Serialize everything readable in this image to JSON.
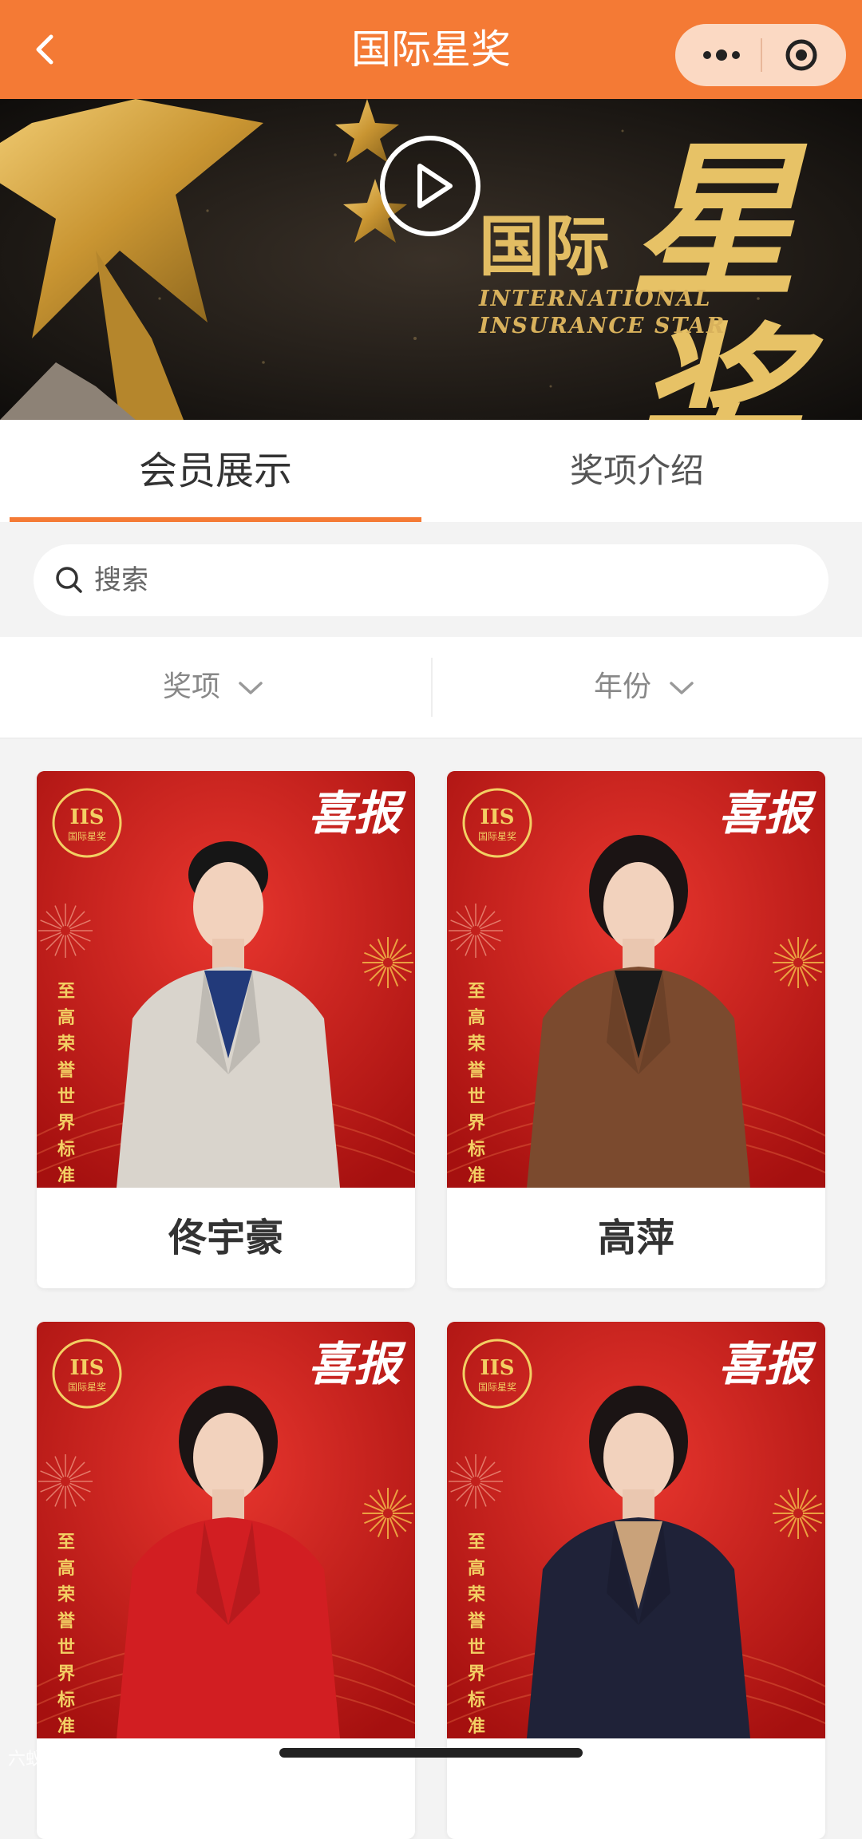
{
  "navbar": {
    "title": "国际星奖"
  },
  "banner": {
    "title_zh_small": "国际",
    "title_zh_big": "星奖",
    "title_en_line1": "INTERNATIONAL",
    "title_en_line2": "INSURANCE STAR"
  },
  "tabs": [
    {
      "label": "会员展示",
      "active": true
    },
    {
      "label": "奖项介绍",
      "active": false
    }
  ],
  "search": {
    "placeholder": "搜索"
  },
  "filters": [
    {
      "label": "奖项"
    },
    {
      "label": "年份"
    }
  ],
  "card_poster": {
    "logo_text": "IIS",
    "logo_sub": "国际星奖",
    "headline": "喜报",
    "vertical_text": "至高荣誉 世界标准"
  },
  "members": [
    {
      "name": "佟宇豪",
      "suit_color": "#d9d4cc",
      "shirt_color": "#223a7a"
    },
    {
      "name": "高萍",
      "suit_color": "#7b4a2e",
      "shirt_color": "#1a1a1a"
    },
    {
      "name": "",
      "suit_color": "#d21e22",
      "shirt_color": "#d21e22"
    },
    {
      "name": "",
      "suit_color": "#1f2238",
      "shirt_color": "#c9a27a"
    }
  ],
  "watermark": "六蚁跨境",
  "colors": {
    "accent": "#f47a35",
    "poster_red": "#c81f1f",
    "gold": "#e2bd63"
  }
}
